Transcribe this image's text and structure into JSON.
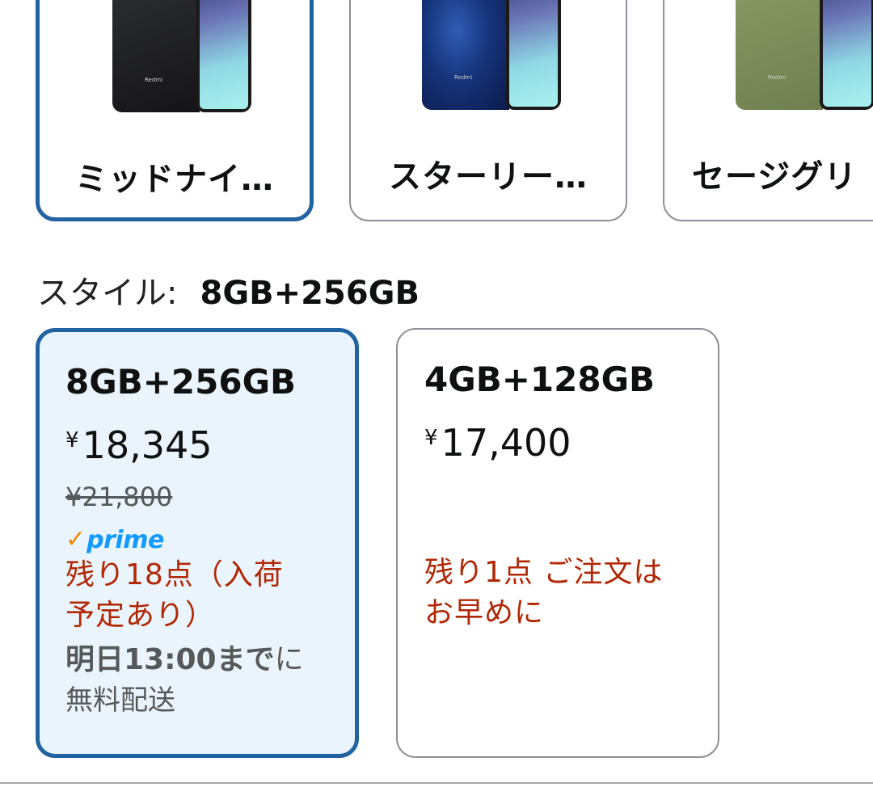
{
  "colors": {
    "accent": "#2162a1",
    "selected_card_bg": "#eaf4fd",
    "stock_red": "#b12704",
    "prime_check": "#f08804",
    "prime_blue": "#1399ff"
  },
  "color_options": [
    {
      "label": "ミッドナイ…",
      "selected": true,
      "phone_brand": "Redmi"
    },
    {
      "label": "スターリー…",
      "selected": false,
      "phone_brand": "Redmi"
    },
    {
      "label": "セージグリ",
      "selected": false,
      "phone_brand": "Redmi"
    }
  ],
  "style": {
    "key": "スタイル:",
    "value": "8GB+256GB"
  },
  "style_options": [
    {
      "size": "8GB+256GB",
      "currency": "¥",
      "price": "18,345",
      "list_price": "¥21,800",
      "prime": {
        "check": "✓",
        "word": "prime"
      },
      "stock_line1": "残り18点（入荷",
      "stock_line2": "予定あり）",
      "delivery_bold": "明日13:00まで",
      "delivery_rest": "に",
      "shipping": "無料配送",
      "selected": true
    },
    {
      "size": "4GB+128GB",
      "currency": "¥",
      "price": "17,400",
      "stock_line1": "残り1点 ご注文は",
      "stock_line2": "お早めに",
      "selected": false
    }
  ]
}
